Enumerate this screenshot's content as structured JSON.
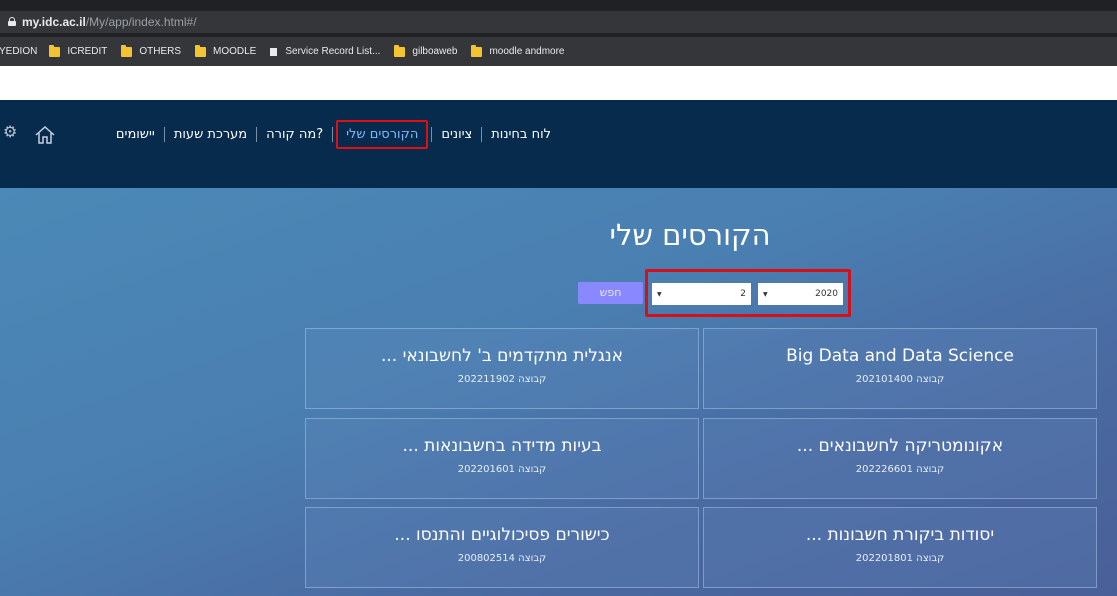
{
  "browser": {
    "url_host": "my.idc.ac.il",
    "url_path": "/My/app/index.html#/",
    "bookmarks": [
      {
        "label": "YEDION",
        "icon": "none"
      },
      {
        "label": "ICREDIT",
        "icon": "folder-icon"
      },
      {
        "label": "OTHERS",
        "icon": "folder-icon"
      },
      {
        "label": "MOODLE",
        "icon": "folder-icon"
      },
      {
        "label": "Service Record List...",
        "icon": "page-icon"
      },
      {
        "label": "gilboaweb",
        "icon": "folder-icon"
      },
      {
        "label": "moodle andmore",
        "icon": "folder-icon"
      }
    ]
  },
  "nav": {
    "items": [
      {
        "label": "לוח בחינות",
        "active": false
      },
      {
        "label": "ציונים",
        "active": false
      },
      {
        "label": "הקורסים שלי",
        "active": true
      },
      {
        "label": "מה קורה?",
        "active": false
      },
      {
        "label": "מערכת שעות",
        "active": false
      },
      {
        "label": "יישומים",
        "active": false
      }
    ],
    "home_icon": "home-icon",
    "settings_icon": "gear-icon"
  },
  "page": {
    "title": "הקורסים שלי"
  },
  "filters": {
    "year": "2020",
    "semester": "2",
    "search_label": "חפש"
  },
  "courses": [
    {
      "name": "Big Data and Data Science",
      "group": "קבוצה 202101400"
    },
    {
      "name": "אנגלית מתקדמים ב' לחשבונאי ...",
      "group": "קבוצה 202211902"
    },
    {
      "name": "אקונומטריקה לחשבונאים ...",
      "group": "קבוצה 202226601"
    },
    {
      "name": "בעיות מדידה בחשבונאות ...",
      "group": "קבוצה 202201601"
    },
    {
      "name": "יסודות ביקורת חשבונות ...",
      "group": "קבוצה 202201801"
    },
    {
      "name": "כישורים פסיכולוגיים והתנסו ...",
      "group": "קבוצה 200802514"
    }
  ],
  "colors": {
    "nav_bg": "#072b4d",
    "active_link": "#7fb8ff",
    "highlight_border": "#d4111a",
    "search_button": "#8a88ff"
  }
}
